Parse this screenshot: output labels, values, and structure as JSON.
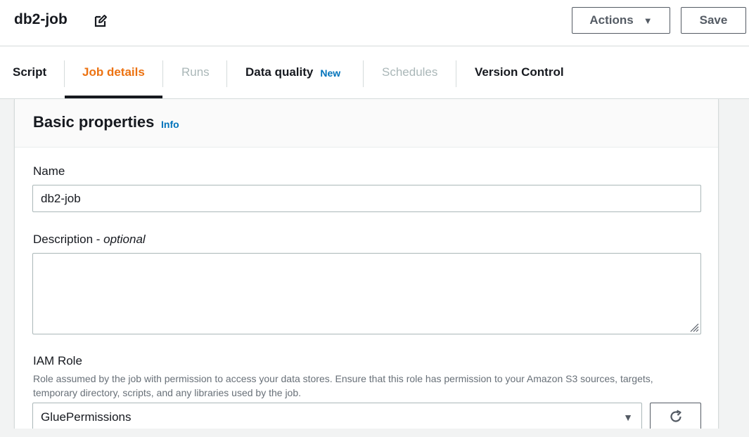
{
  "header": {
    "job_name": "db2-job",
    "actions_label": "Actions",
    "save_label": "Save"
  },
  "tabs": [
    {
      "label": "Script",
      "state": "enabled"
    },
    {
      "label": "Job details",
      "state": "active"
    },
    {
      "label": "Runs",
      "state": "disabled"
    },
    {
      "label": "Data quality",
      "state": "enabled",
      "badge": "New"
    },
    {
      "label": "Schedules",
      "state": "disabled"
    },
    {
      "label": "Version Control",
      "state": "enabled"
    }
  ],
  "panel": {
    "title": "Basic properties",
    "info_label": "Info",
    "name": {
      "label": "Name",
      "value": "db2-job"
    },
    "description": {
      "label": "Description - ",
      "label_optional": "optional",
      "value": ""
    },
    "iam_role": {
      "label": "IAM Role",
      "description": "Role assumed by the job with permission to access your data stores. Ensure that this role has permission to your Amazon S3 sources, targets, temporary directory, scripts, and any libraries used by the job.",
      "selected": "GluePermissions"
    }
  },
  "colors": {
    "active_tab": "#ec7211",
    "link": "#0073bb",
    "disabled": "#aab7b8",
    "border": "#aab7b8"
  },
  "icons": {
    "edit": "edit-icon",
    "caret": "caret-down-icon",
    "refresh": "refresh-icon",
    "resize": "resize-handle-icon"
  }
}
